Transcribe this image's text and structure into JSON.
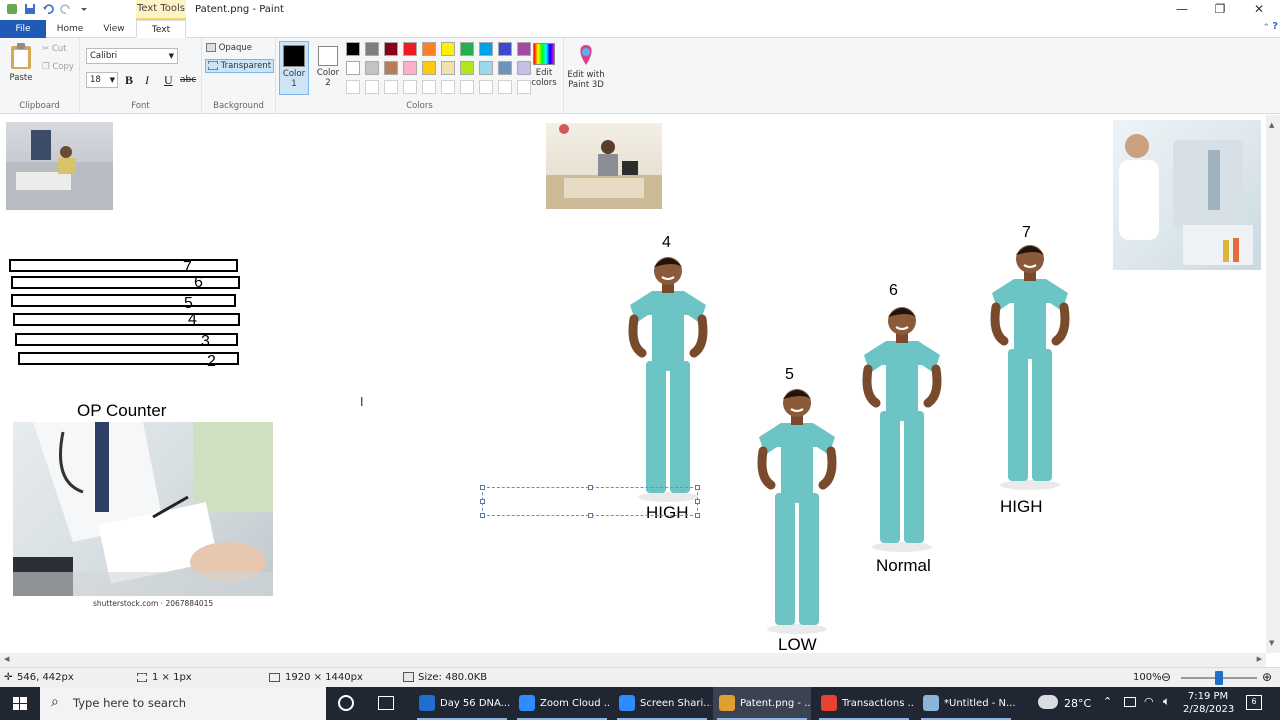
{
  "window": {
    "title": "Patent.png - Paint",
    "context_tab": "Text Tools",
    "controls": [
      "—",
      "❐",
      "✕"
    ]
  },
  "tabs": {
    "file": "File",
    "home": "Home",
    "view": "View",
    "text": "Text"
  },
  "ribbon": {
    "clipboard": {
      "paste": "Paste",
      "cut": "Cut",
      "copy": "Copy",
      "label": "Clipboard"
    },
    "font": {
      "family": "Calibri",
      "size": "18",
      "bold": "B",
      "italic": "I",
      "underline": "U",
      "strike": "abc",
      "label": "Font"
    },
    "background": {
      "opaque": "Opaque",
      "transparent": "Transparent",
      "label": "Background"
    },
    "color1": {
      "line1": "Color",
      "line2": "1"
    },
    "color2": {
      "line1": "Color",
      "line2": "2"
    },
    "colors_label": "Colors",
    "edit_colors": {
      "line1": "Edit",
      "line2": "colors"
    },
    "paint3d": {
      "line1": "Edit with",
      "line2": "Paint 3D"
    },
    "palette_row1": [
      "#000000",
      "#7f7f7f",
      "#880015",
      "#ed1c24",
      "#ff7f27",
      "#fff200",
      "#22b14c",
      "#00a2e8",
      "#3f48cc",
      "#a349a4"
    ],
    "palette_row2": [
      "#ffffff",
      "#c3c3c3",
      "#b97a57",
      "#ffaec9",
      "#ffc90e",
      "#efe4b0",
      "#b5e61d",
      "#99d9ea",
      "#7092be",
      "#c8bfe7"
    ]
  },
  "canvas": {
    "counter_numbers": [
      "7",
      "6",
      "5",
      "4",
      "3",
      "2"
    ],
    "counter_label": "OP Counter",
    "photo_caption": "shutterstock.com · 2067884015",
    "figures": [
      {
        "number": "4",
        "label": "HIGH"
      },
      {
        "number": "5",
        "label": "LOW"
      },
      {
        "number": "6",
        "label": "Normal"
      },
      {
        "number": "7",
        "label": "HIGH"
      }
    ]
  },
  "statusbar": {
    "cursor": "546, 442px",
    "selection": "1 × 1px",
    "dimensions": "1920 × 1440px",
    "size": "Size: 480.0KB",
    "zoom": "100%",
    "zoom_level": 0.5
  },
  "taskbar": {
    "search_placeholder": "Type here to search",
    "apps": [
      {
        "label": "Day 56 DNA...",
        "color": "#1f6fd1"
      },
      {
        "label": "Zoom Cloud ...",
        "color": "#2d8cff"
      },
      {
        "label": "Screen Shari...",
        "color": "#2d8cff"
      },
      {
        "label": "Patent.png - ...",
        "color": "#e0a030"
      },
      {
        "label": "Transactions ...",
        "color": "#e94235"
      },
      {
        "label": "*Untitled - N...",
        "color": "#8ab4d8"
      }
    ],
    "temperature": "28°C",
    "time": "7:19 PM",
    "date": "2/28/2023",
    "notifications": "6"
  }
}
